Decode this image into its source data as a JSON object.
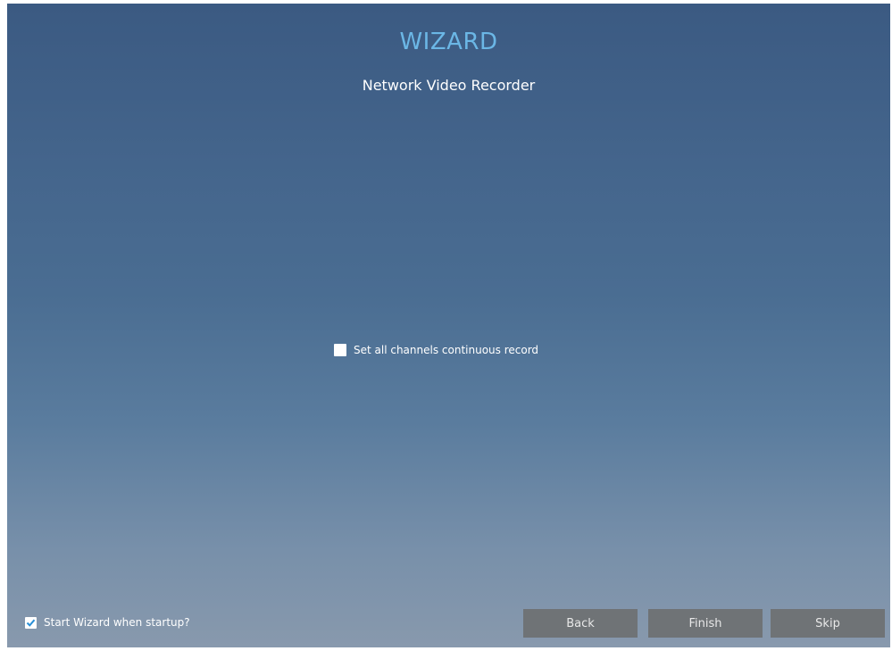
{
  "header": {
    "title": "WIZARD",
    "subtitle": "Network Video Recorder"
  },
  "record_option": {
    "label": "Set all channels continuous record",
    "checked": false
  },
  "startup_option": {
    "label": "Start Wizard when startup?",
    "checked": true
  },
  "buttons": {
    "back": "Back",
    "finish": "Finish",
    "skip": "Skip"
  },
  "colors": {
    "title": "#6bb7e6",
    "button_bg": "#6f7376",
    "checkmark": "#2a8fd6"
  }
}
